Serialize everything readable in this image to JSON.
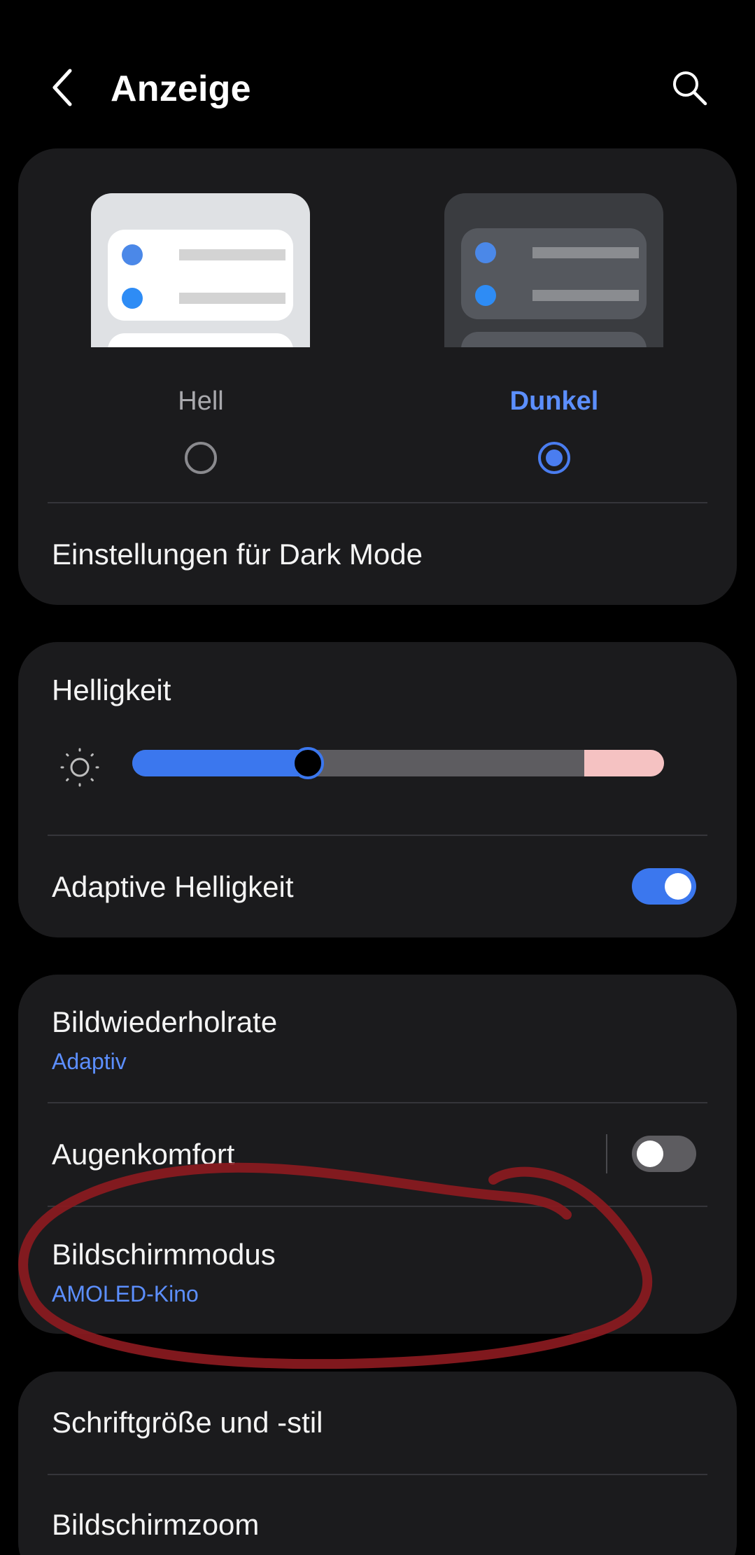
{
  "header": {
    "title": "Anzeige",
    "back_icon": "chevron-left-icon",
    "search_icon": "search-icon"
  },
  "theme": {
    "options": [
      {
        "label": "Hell",
        "selected": false
      },
      {
        "label": "Dunkel",
        "selected": true
      }
    ],
    "dark_mode_settings": "Einstellungen für Dark Mode"
  },
  "brightness": {
    "title": "Helligkeit",
    "icon": "sun-icon",
    "level_fraction": 0.33,
    "extra_brightness_fraction": 0.15,
    "adaptive_label": "Adaptive Helligkeit",
    "adaptive_on": true
  },
  "display": {
    "refresh_rate_title": "Bildwiederholrate",
    "refresh_rate_value": "Adaptiv",
    "eye_comfort_title": "Augenkomfort",
    "eye_comfort_on": false,
    "screen_mode_title": "Bildschirmmodus",
    "screen_mode_value": "AMOLED-Kino"
  },
  "font": {
    "font_size_title": "Schriftgröße und -stil",
    "screen_zoom_title": "Bildschirmzoom"
  },
  "colors": {
    "background": "#000000",
    "card": "#1b1b1d",
    "accent": "#3b77ee",
    "accent_text": "#5c8fff",
    "selected_label": "#5c8fff",
    "unselected_label": "#a9a9ad",
    "annotation": "#8b1a1f"
  }
}
